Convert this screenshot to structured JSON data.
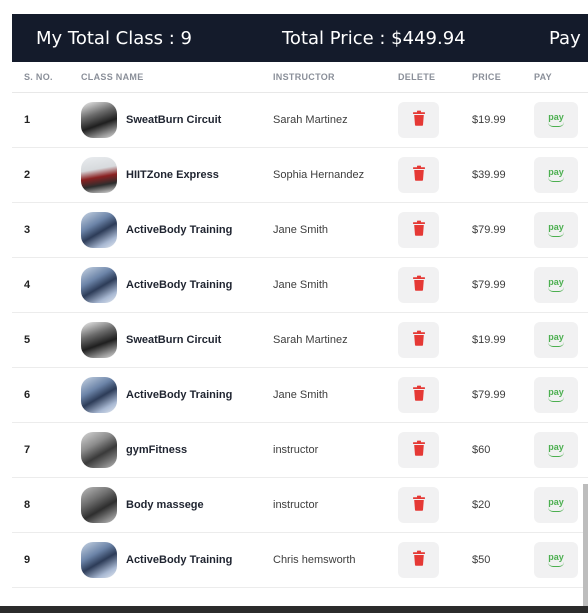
{
  "header": {
    "total_class": "My Total Class : 9",
    "total_price": "Total Price : $449.94",
    "pay_label": "Pay"
  },
  "table": {
    "columns": [
      "S. NO.",
      "CLASS NAME",
      "INSTRUCTOR",
      "DELETE",
      "PRICE",
      "PAY"
    ],
    "pay_button_text": "pay",
    "rows": [
      {
        "sno": "1",
        "name": "SweatBurn Circuit",
        "instructor": "Sarah Martinez",
        "price": "$19.99",
        "thumb": "gym-photo"
      },
      {
        "sno": "2",
        "name": "HIITZone Express",
        "instructor": "Sophia Hernandez",
        "price": "$39.99",
        "thumb": "hiit-photo"
      },
      {
        "sno": "3",
        "name": "ActiveBody Training",
        "instructor": "Jane Smith",
        "price": "$79.99",
        "thumb": "activebody-photo"
      },
      {
        "sno": "4",
        "name": "ActiveBody Training",
        "instructor": "Jane Smith",
        "price": "$79.99",
        "thumb": "activebody-photo"
      },
      {
        "sno": "5",
        "name": "SweatBurn Circuit",
        "instructor": "Sarah Martinez",
        "price": "$19.99",
        "thumb": "gym-photo"
      },
      {
        "sno": "6",
        "name": "ActiveBody Training",
        "instructor": "Jane Smith",
        "price": "$79.99",
        "thumb": "activebody-photo"
      },
      {
        "sno": "7",
        "name": "gymFitness",
        "instructor": "instructor",
        "price": "$60",
        "thumb": "fitness-photo"
      },
      {
        "sno": "8",
        "name": "Body massege",
        "instructor": "instructor",
        "price": "$20",
        "thumb": "massage-photo"
      },
      {
        "sno": "9",
        "name": "ActiveBody Training",
        "instructor": "Chris hemsworth",
        "price": "$50",
        "thumb": "activebody-photo"
      }
    ]
  },
  "icons": {
    "delete": "trash-icon",
    "pay": "amazon-pay-icon"
  },
  "colors": {
    "header_bg": "#141b2b",
    "delete_red": "#e53935",
    "pay_green": "#4caf50"
  }
}
